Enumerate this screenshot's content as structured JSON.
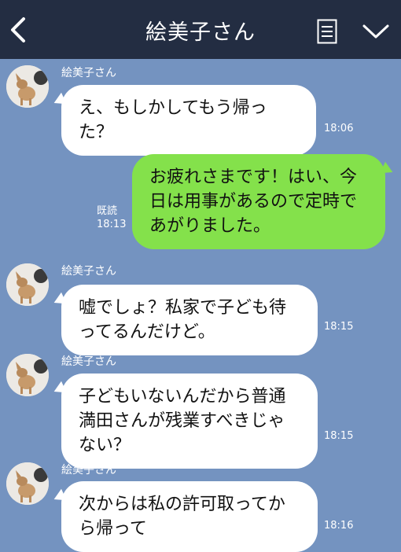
{
  "header": {
    "title": "絵美子さん",
    "icons": [
      "back-chevron-icon",
      "menu-list-icon",
      "expand-chevron-icon"
    ]
  },
  "messages": [
    {
      "sender": "絵美子さん",
      "text": "え、もしかしてもう帰った？",
      "time": "18:06",
      "direction": "in"
    },
    {
      "text": "お疲れさまです！はい、今日は用事があるので定時であがりました。",
      "read_label": "既読",
      "time": "18:13",
      "direction": "out"
    },
    {
      "sender": "絵美子さん",
      "text": "嘘でしょ？私家で子ども待ってるんだけど。",
      "time": "18:15",
      "direction": "in"
    },
    {
      "sender": "絵美子さん",
      "text": "子どもいないんだから普通満田さんが残業すべきじゃない？",
      "time": "18:15",
      "direction": "in"
    },
    {
      "sender": "絵美子さん",
      "text": "次からは私の許可取ってから帰って",
      "time": "18:16",
      "direction": "in"
    }
  ],
  "colors": {
    "header_bg": "#232d42",
    "chat_bg": "#7493c0",
    "outgoing_bubble": "#84e14b",
    "incoming_bubble": "#ffffff"
  }
}
